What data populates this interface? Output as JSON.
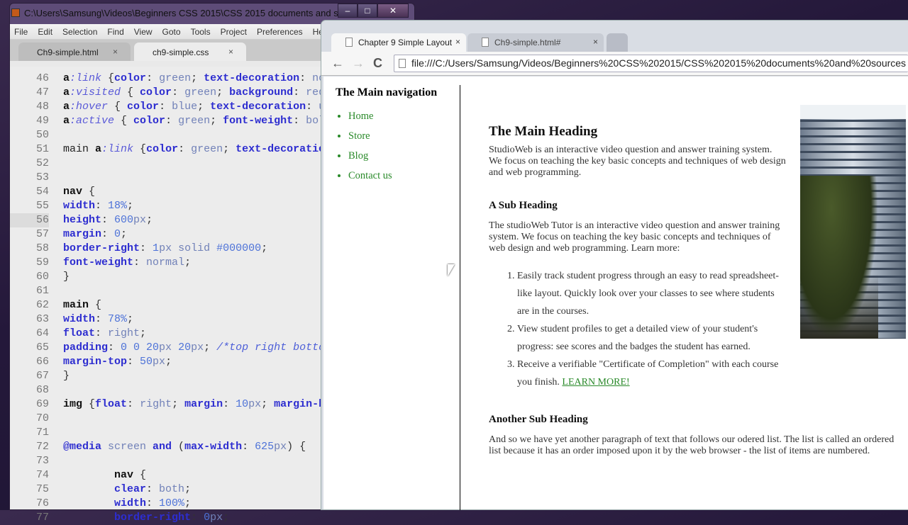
{
  "editor": {
    "title": "C:\\Users\\Samsung\\Videos\\Beginners CSS 2015\\CSS 2015 documents and sources...",
    "menu": [
      "File",
      "Edit",
      "Selection",
      "Find",
      "View",
      "Goto",
      "Tools",
      "Project",
      "Preferences",
      "He"
    ],
    "tabs": [
      {
        "label": "Ch9-simple.html",
        "close": "×"
      },
      {
        "label": "ch9-simple.css",
        "close": "×"
      }
    ],
    "window_buttons": [
      "‒",
      "□",
      "✕"
    ],
    "lines": [
      {
        "n": "46",
        "t": [
          [
            "sel",
            "a"
          ],
          [
            "pseudo",
            ":link"
          ],
          [
            "p",
            " {"
          ],
          [
            "prop",
            "color"
          ],
          [
            "p",
            ": "
          ],
          [
            "val",
            "green"
          ],
          [
            "p",
            "; "
          ],
          [
            "prop",
            "text-decoration"
          ],
          [
            "p",
            ": "
          ],
          [
            "val",
            "nor"
          ]
        ]
      },
      {
        "n": "47",
        "t": [
          [
            "sel",
            "a"
          ],
          [
            "pseudo",
            ":visited"
          ],
          [
            "p",
            " { "
          ],
          [
            "prop",
            "color"
          ],
          [
            "p",
            ": "
          ],
          [
            "val",
            "green"
          ],
          [
            "p",
            "; "
          ],
          [
            "prop",
            "background"
          ],
          [
            "p",
            ": "
          ],
          [
            "val",
            "red"
          ],
          [
            "p",
            ";"
          ]
        ]
      },
      {
        "n": "48",
        "t": [
          [
            "sel",
            "a"
          ],
          [
            "pseudo",
            ":hover"
          ],
          [
            "p",
            " { "
          ],
          [
            "prop",
            "color"
          ],
          [
            "p",
            ": "
          ],
          [
            "val",
            "blue"
          ],
          [
            "p",
            "; "
          ],
          [
            "prop",
            "text-decoration"
          ],
          [
            "p",
            ": "
          ],
          [
            "val",
            "ur"
          ]
        ]
      },
      {
        "n": "49",
        "t": [
          [
            "sel",
            "a"
          ],
          [
            "pseudo",
            ":active"
          ],
          [
            "p",
            " { "
          ],
          [
            "prop",
            "color"
          ],
          [
            "p",
            ": "
          ],
          [
            "val",
            "green"
          ],
          [
            "p",
            "; "
          ],
          [
            "prop",
            "font-weight"
          ],
          [
            "p",
            ": "
          ],
          [
            "val",
            "bolc"
          ]
        ]
      },
      {
        "n": "50",
        "t": []
      },
      {
        "n": "51",
        "t": [
          [
            "plain",
            "main "
          ],
          [
            "sel",
            "a"
          ],
          [
            "pseudo",
            ":link"
          ],
          [
            "p",
            " {"
          ],
          [
            "prop",
            "color"
          ],
          [
            "p",
            ": "
          ],
          [
            "val",
            "green"
          ],
          [
            "p",
            "; "
          ],
          [
            "prop",
            "text-decoration"
          ]
        ]
      },
      {
        "n": "52",
        "t": []
      },
      {
        "n": "53",
        "t": []
      },
      {
        "n": "54",
        "t": [
          [
            "sel",
            "nav"
          ],
          [
            "p",
            " {"
          ]
        ]
      },
      {
        "n": "55",
        "t": [
          [
            "prop",
            "width"
          ],
          [
            "p",
            ": "
          ],
          [
            "num",
            "18%"
          ],
          [
            "p",
            ";"
          ]
        ]
      },
      {
        "n": "56",
        "t": [
          [
            "prop",
            "height"
          ],
          [
            "p",
            ": "
          ],
          [
            "num",
            "600"
          ],
          [
            "val",
            "px"
          ],
          [
            "p",
            ";"
          ]
        ]
      },
      {
        "n": "57",
        "t": [
          [
            "prop",
            "margin"
          ],
          [
            "p",
            ": "
          ],
          [
            "num",
            "0"
          ],
          [
            "p",
            ";"
          ]
        ]
      },
      {
        "n": "58",
        "t": [
          [
            "prop",
            "border-right"
          ],
          [
            "p",
            ": "
          ],
          [
            "num",
            "1"
          ],
          [
            "val",
            "px solid "
          ],
          [
            "num",
            "#000000"
          ],
          [
            "p",
            ";"
          ]
        ]
      },
      {
        "n": "59",
        "t": [
          [
            "prop",
            "font-weight"
          ],
          [
            "p",
            ": "
          ],
          [
            "val",
            "normal"
          ],
          [
            "p",
            ";"
          ]
        ]
      },
      {
        "n": "60",
        "t": [
          [
            "p",
            "}"
          ]
        ]
      },
      {
        "n": "61",
        "t": []
      },
      {
        "n": "62",
        "t": [
          [
            "sel",
            "main"
          ],
          [
            "p",
            " {"
          ]
        ]
      },
      {
        "n": "63",
        "t": [
          [
            "prop",
            "width"
          ],
          [
            "p",
            ": "
          ],
          [
            "num",
            "78%"
          ],
          [
            "p",
            ";"
          ]
        ]
      },
      {
        "n": "64",
        "t": [
          [
            "prop",
            "float"
          ],
          [
            "p",
            ": "
          ],
          [
            "val",
            "right"
          ],
          [
            "p",
            ";"
          ]
        ]
      },
      {
        "n": "65",
        "t": [
          [
            "prop",
            "padding"
          ],
          [
            "p",
            ": "
          ],
          [
            "num",
            "0 0 20"
          ],
          [
            "val",
            "px "
          ],
          [
            "num",
            "20"
          ],
          [
            "val",
            "px"
          ],
          [
            "p",
            "; "
          ],
          [
            "com",
            "/*top right bottom"
          ]
        ]
      },
      {
        "n": "66",
        "t": [
          [
            "prop",
            "margin-top"
          ],
          [
            "p",
            ": "
          ],
          [
            "num",
            "50"
          ],
          [
            "val",
            "px"
          ],
          [
            "p",
            ";"
          ]
        ]
      },
      {
        "n": "67",
        "t": [
          [
            "p",
            "}"
          ]
        ]
      },
      {
        "n": "68",
        "t": []
      },
      {
        "n": "69",
        "t": [
          [
            "sel",
            "img"
          ],
          [
            "p",
            " {"
          ],
          [
            "prop",
            "float"
          ],
          [
            "p",
            ": "
          ],
          [
            "val",
            "right"
          ],
          [
            "p",
            "; "
          ],
          [
            "prop",
            "margin"
          ],
          [
            "p",
            ": "
          ],
          [
            "num",
            "10"
          ],
          [
            "val",
            "px"
          ],
          [
            "p",
            "; "
          ],
          [
            "prop",
            "margin-bo"
          ]
        ]
      },
      {
        "n": "70",
        "t": []
      },
      {
        "n": "71",
        "t": []
      },
      {
        "n": "72",
        "t": [
          [
            "prop",
            "@media"
          ],
          [
            "val",
            " screen "
          ],
          [
            "prop",
            "and"
          ],
          [
            "p",
            " ("
          ],
          [
            "prop",
            "max-width"
          ],
          [
            "p",
            ": "
          ],
          [
            "num",
            "625"
          ],
          [
            "val",
            "px"
          ],
          [
            "p",
            ") {"
          ]
        ]
      },
      {
        "n": "73",
        "t": []
      },
      {
        "n": "74",
        "t": [
          [
            "sel",
            "        nav"
          ],
          [
            "p",
            " {"
          ]
        ]
      },
      {
        "n": "75",
        "t": [
          [
            "p",
            "        "
          ],
          [
            "prop",
            "clear"
          ],
          [
            "p",
            ": "
          ],
          [
            "val",
            "both"
          ],
          [
            "p",
            ";"
          ]
        ]
      },
      {
        "n": "76",
        "t": [
          [
            "p",
            "        "
          ],
          [
            "prop",
            "width"
          ],
          [
            "p",
            ": "
          ],
          [
            "num",
            "100%"
          ],
          [
            "p",
            ";"
          ]
        ]
      },
      {
        "n": "77",
        "t": [
          [
            "p",
            "        "
          ],
          [
            "prop",
            "border-right"
          ],
          [
            "p",
            ": "
          ],
          [
            "num",
            "0"
          ],
          [
            "val",
            "px"
          ],
          [
            "p",
            ";"
          ]
        ]
      }
    ]
  },
  "browser": {
    "tabs": [
      {
        "label": "Chapter 9 Simple Layout",
        "close": "×"
      },
      {
        "label": "Ch9-simple.html#",
        "close": "×"
      }
    ],
    "nav_buttons": [
      "←",
      "→",
      "C"
    ],
    "url": "file:///C:/Users/Samsung/Videos/Beginners%20CSS%202015/CSS%202015%20documents%20and%20sources",
    "page": {
      "nav_heading": "The Main navigation",
      "nav_links": [
        "Home",
        "Store",
        "Blog",
        "Contact us"
      ],
      "heading": "The Main Heading",
      "intro": "StudioWeb is an interactive video question and answer training system. We focus on teaching the key basic concepts and techniques of web design and web programming.",
      "sub1": "A Sub Heading",
      "para1": "The studioWeb Tutor is an interactive video question and answer training system. We focus on teaching the key basic concepts and techniques of web design and web programming. Learn more:",
      "list": [
        "Easily track student progress through an easy to read spreadsheet-like layout. Quickly look over your classes to see where students are in the courses.",
        "View student profiles to get a detailed view of your student's progress: see scores and the badges the student has earned.",
        "Receive a verifiable \"Certificate of Completion\" with each course you finish. "
      ],
      "learn_more": "LEARN MORE!",
      "sub2": "Another Sub Heading",
      "para2": "And so we have yet another paragraph of text that follows our odered list. The list is called an ordered list because it has an order imposed upon it by the web browser - the list of items are numbered."
    }
  }
}
